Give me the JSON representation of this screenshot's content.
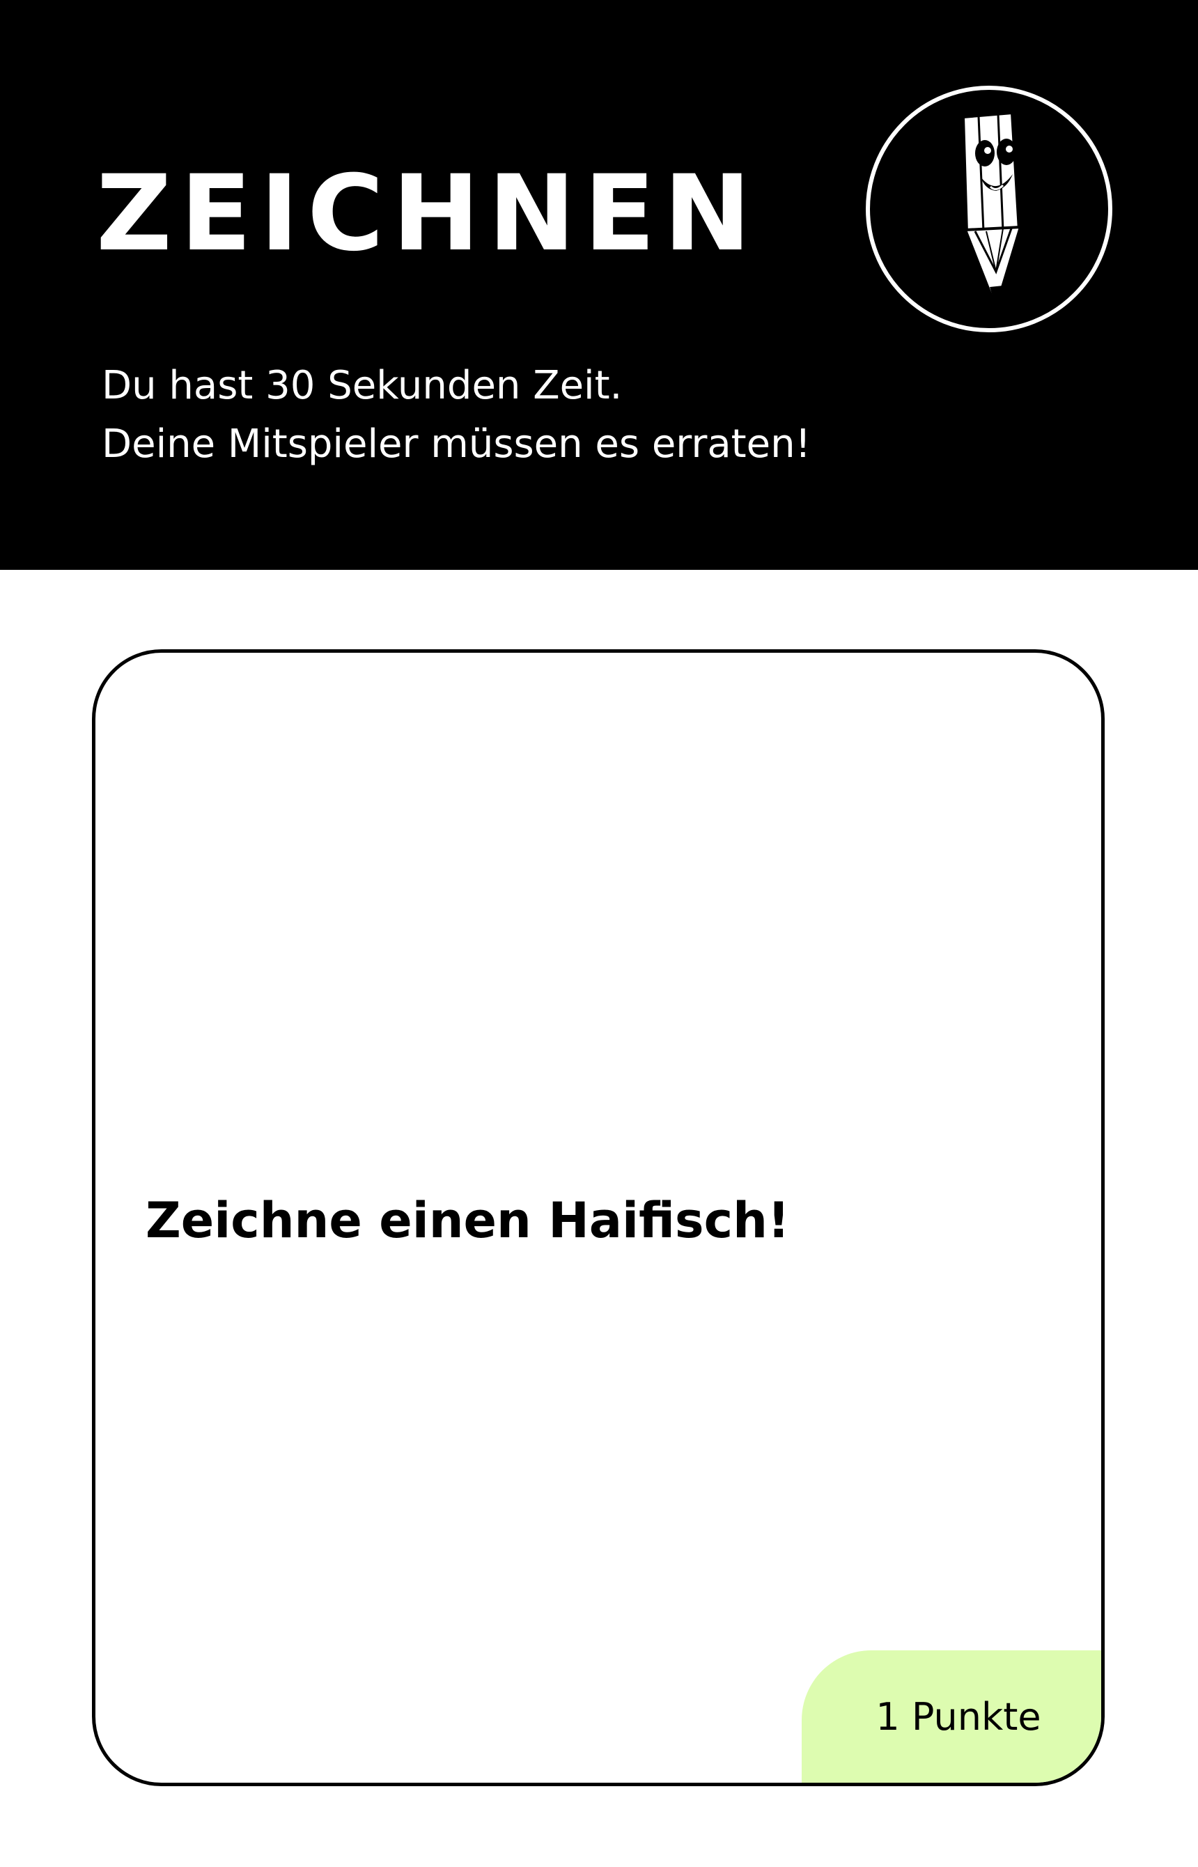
{
  "header": {
    "title": "ZEICHNEN",
    "icon": "smiling-pencil-icon",
    "instructions": [
      "Du hast 30 Sekunden Zeit.",
      "Deine Mitspieler müssen es erraten!"
    ]
  },
  "card": {
    "prompt": "Zeichne einen Haifisch!",
    "points_label": "1 Punkte"
  },
  "colors": {
    "header_background": "#000000",
    "header_text": "#ffffff",
    "card_border": "#000000",
    "points_badge": "#ddfcb0"
  }
}
